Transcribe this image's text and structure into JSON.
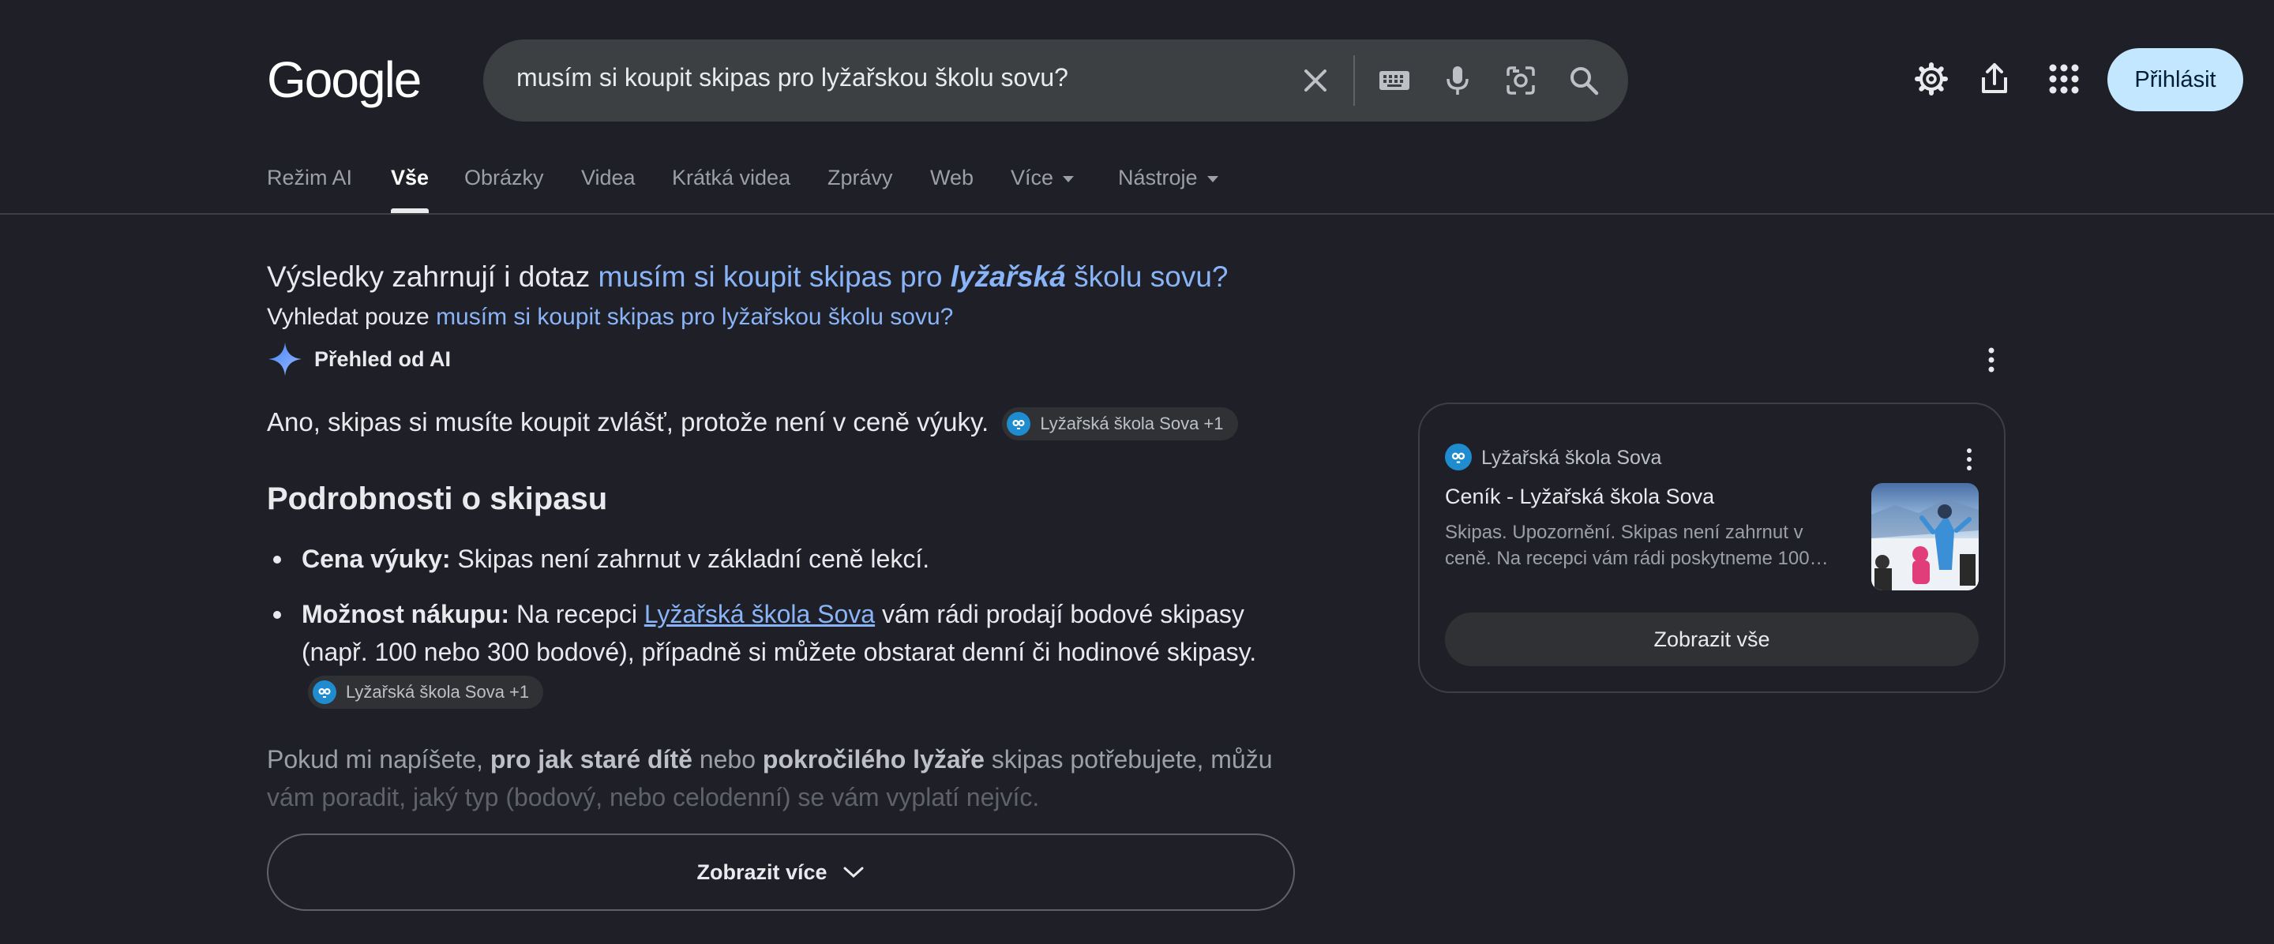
{
  "header": {
    "logo": "Google",
    "search_query": "musím si koupit skipas pro lyžařskou školu sovu?",
    "icons": [
      "close-icon",
      "keyboard-icon",
      "microphone-icon",
      "lens-icon",
      "search-icon",
      "gear-icon",
      "share-icon",
      "apps-icon"
    ],
    "login_label": "Přihlásit"
  },
  "tabs": {
    "items": [
      {
        "label": "Režim AI"
      },
      {
        "label": "Vše"
      },
      {
        "label": "Obrázky"
      },
      {
        "label": "Videa"
      },
      {
        "label": "Krátká videa"
      },
      {
        "label": "Zprávy"
      },
      {
        "label": "Web"
      },
      {
        "label": "Více"
      },
      {
        "label": "Nástroje"
      }
    ],
    "active": "Vše"
  },
  "correction": {
    "prefix": "Výsledky zahrnují i dotaz",
    "link_part1": "musím si koupit skipas pro",
    "link_bold": "lyžařská",
    "link_part2": "školu sovu?",
    "only_prefix": "Vyhledat pouze",
    "only_link": "musím si koupit skipas pro lyžařskou školu sovu?"
  },
  "ai_overview": {
    "label": "Přehled od AI",
    "answer": "Ano, skipas si musíte koupit zvlášť, protože není v ceně výuky.",
    "chip_label": "Lyžařská škola Sova +1",
    "heading": "Podrobnosti o skipasu",
    "bullet1_bold": "Cena výuky:",
    "bullet1_text": "Skipas není zahrnut v základní ceně lekcí.",
    "bullet2_bold": "Možnost nákupu:",
    "bullet2_text_a": "Na recepci",
    "bullet2_link": "Lyžařská škola Sova",
    "bullet2_text_b": "vám rádi prodají bodové skipasy (např. 100 nebo 300 bodové), případně si můžete obstarat denní či hodinové skipasy.",
    "followup_a": "Pokud mi napíšete,",
    "followup_b1": "pro jak staré dítě",
    "followup_c": "nebo",
    "followup_b2": "pokročilého lyžaře",
    "followup_d": "skipas potřebujete, můžu",
    "followup_line2": "vám poradit, jaký typ (bodový, nebo celodenní) se vám vyplatí nejvíc.",
    "show_more": "Zobrazit více"
  },
  "source_card": {
    "source": "Lyžařská škola Sova",
    "title": "Ceník - Lyžařská škola Sova",
    "snippet": "Skipas. Upozornění. Skipas není zahrnut v ceně. Na recepci vám rádi poskytneme 100…",
    "show_all": "Zobrazit vše"
  },
  "colors": {
    "background": "#1f2027",
    "link": "#8ab4f8",
    "login_bg": "#c2e7ff",
    "search_bg": "#3c4043"
  }
}
